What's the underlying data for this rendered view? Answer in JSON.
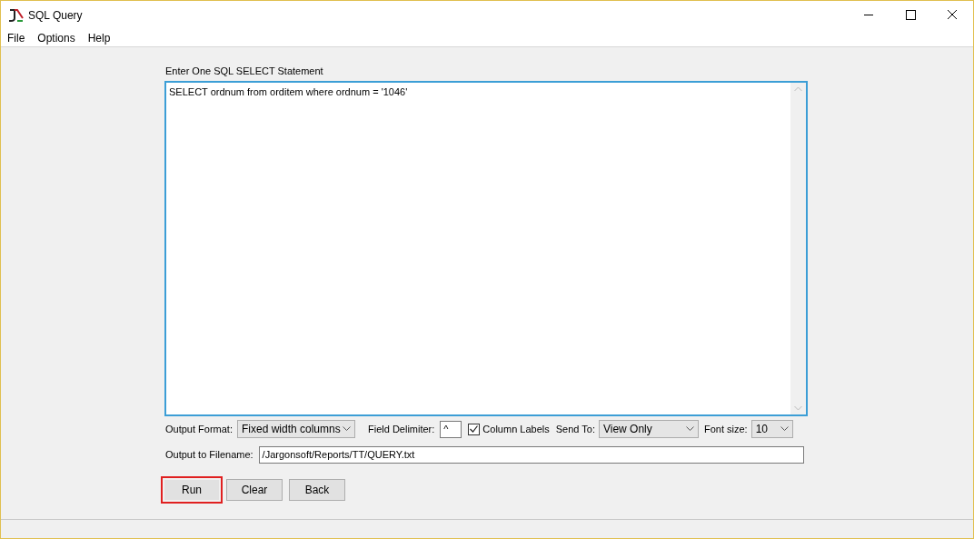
{
  "window": {
    "title": "SQL Query"
  },
  "menu": [
    "File",
    "Options",
    "Help"
  ],
  "query": {
    "label": "Enter One SQL SELECT Statement",
    "value": "SELECT ordnum from orditem where ordnum = '1046'"
  },
  "output_format": {
    "label": "Output Format:",
    "value": "Fixed width columns"
  },
  "field_delimiter": {
    "label": "Field Delimiter:",
    "value": "^"
  },
  "column_labels": {
    "label": "Column Labels",
    "checked": true
  },
  "send_to": {
    "label": "Send To:",
    "value": "View Only"
  },
  "font_size": {
    "label": "Font size:",
    "value": "10"
  },
  "output_filename": {
    "label": "Output to Filename:",
    "value": "/Jargonsoft/Reports/TT/QUERY.txt"
  },
  "buttons": [
    {
      "label": "Run",
      "highlighted": true
    },
    {
      "label": "Clear",
      "highlighted": false
    },
    {
      "label": "Back",
      "highlighted": false
    }
  ]
}
